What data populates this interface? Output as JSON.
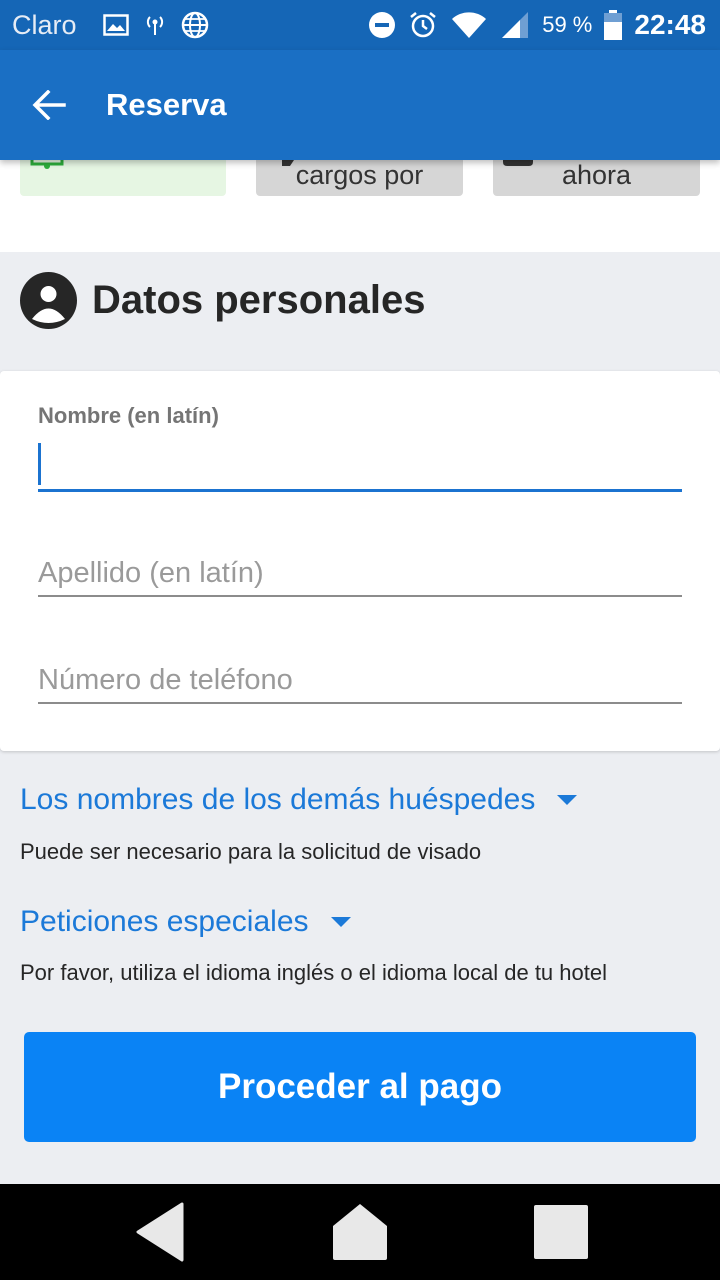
{
  "status_bar": {
    "carrier": "Claro",
    "battery_percent": "59 %",
    "time": "22:48",
    "icons": [
      "image-icon",
      "hotspot-icon",
      "globe-icon",
      "do-not-disturb-icon",
      "alarm-icon",
      "wifi-icon",
      "signal-icon",
      "battery-icon"
    ]
  },
  "app_bar": {
    "title": "Reserva",
    "color": "#1a6fc4"
  },
  "options": [
    {
      "label": "",
      "color": "#e6f6e3"
    },
    {
      "label": "cargos por",
      "color": "#d6d6d6"
    },
    {
      "label": "ahora",
      "color": "#d6d6d6"
    }
  ],
  "section": {
    "title": "Datos personales",
    "icon": "person-icon"
  },
  "form": {
    "first_name": {
      "label": "Nombre (en latín)",
      "value": ""
    },
    "last_name": {
      "placeholder": "Apellido (en latín)",
      "value": ""
    },
    "phone": {
      "placeholder": "Número de teléfono",
      "value": ""
    }
  },
  "guests": {
    "label": "Los nombres de los demás huéspedes",
    "hint": "Puede ser necesario para la solicitud de visado"
  },
  "requests": {
    "label": "Peticiones especiales",
    "hint": "Por favor, utiliza el idioma inglés o el idioma local de tu hotel"
  },
  "proceed_button": {
    "label": "Proceder al pago",
    "color": "#0a83f5"
  },
  "nav": {
    "icons": [
      "back-triangle-icon",
      "home-icon",
      "recents-icon"
    ]
  }
}
